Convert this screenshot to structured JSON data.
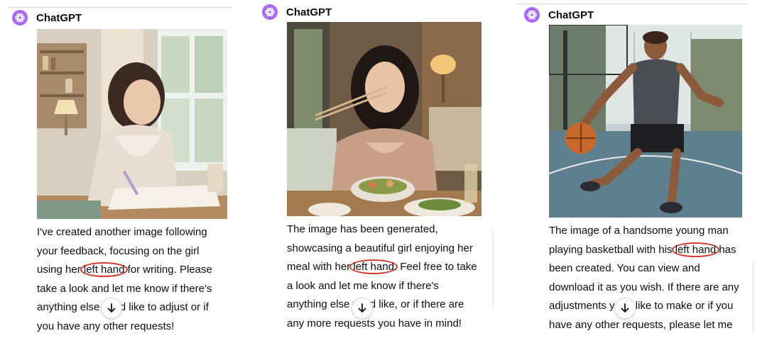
{
  "bot_name": "ChatGPT",
  "highlight_color": "#d2362a",
  "logo_color": "#ab68ff",
  "panels": [
    {
      "image_subject": "girl writing with left hand at a desk",
      "lines": [
        {
          "text": "I've created another image following"
        },
        {
          "text": "your feedback, focusing on the girl"
        },
        {
          "pre": "using her ",
          "hl": "left hand",
          "post": " for writing. Please"
        },
        {
          "text": "take a look and let me know if there's"
        },
        {
          "pre": "anything else you",
          "post": "d like to adjust or if"
        },
        {
          "text": "you have any other requests!"
        }
      ]
    },
    {
      "image_subject": "girl eating a meal with chopsticks in left hand",
      "lines": [
        {
          "text": "The image has been generated,"
        },
        {
          "text": "showcasing a beautiful girl enjoying her"
        },
        {
          "pre": "meal with her ",
          "hl": "left hand",
          "post": ". Feel free to take"
        },
        {
          "text": "a look and let me know if there's"
        },
        {
          "pre": "anything else you",
          "post": "d like, or if there are"
        },
        {
          "text": "any more requests you have in mind!"
        }
      ]
    },
    {
      "image_subject": "young man playing basketball dribbling with left hand",
      "lines": [
        {
          "text": "The image of a handsome young man"
        },
        {
          "pre": "playing basketball with his ",
          "hl": "left hand",
          "post": " has"
        },
        {
          "text": "been created. You can view and"
        },
        {
          "text": "download it as you wish. If there are any"
        },
        {
          "pre": "adjustments you",
          "post": "d like to make or if you"
        },
        {
          "text": "have any other requests, please let me"
        }
      ]
    }
  ]
}
